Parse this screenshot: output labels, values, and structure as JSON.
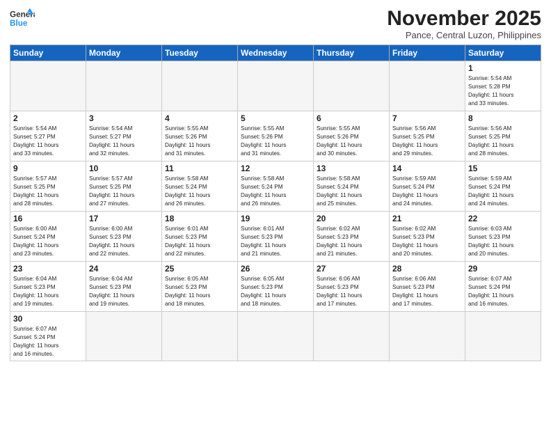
{
  "logo": {
    "line1": "General",
    "line2": "Blue"
  },
  "title": "November 2025",
  "location": "Pance, Central Luzon, Philippines",
  "weekdays": [
    "Sunday",
    "Monday",
    "Tuesday",
    "Wednesday",
    "Thursday",
    "Friday",
    "Saturday"
  ],
  "weeks": [
    [
      {
        "day": "",
        "info": ""
      },
      {
        "day": "",
        "info": ""
      },
      {
        "day": "",
        "info": ""
      },
      {
        "day": "",
        "info": ""
      },
      {
        "day": "",
        "info": ""
      },
      {
        "day": "",
        "info": ""
      },
      {
        "day": "1",
        "info": "Sunrise: 5:54 AM\nSunset: 5:28 PM\nDaylight: 11 hours\nand 33 minutes."
      }
    ],
    [
      {
        "day": "2",
        "info": "Sunrise: 5:54 AM\nSunset: 5:27 PM\nDaylight: 11 hours\nand 33 minutes."
      },
      {
        "day": "3",
        "info": "Sunrise: 5:54 AM\nSunset: 5:27 PM\nDaylight: 11 hours\nand 32 minutes."
      },
      {
        "day": "4",
        "info": "Sunrise: 5:55 AM\nSunset: 5:26 PM\nDaylight: 11 hours\nand 31 minutes."
      },
      {
        "day": "5",
        "info": "Sunrise: 5:55 AM\nSunset: 5:26 PM\nDaylight: 11 hours\nand 31 minutes."
      },
      {
        "day": "6",
        "info": "Sunrise: 5:55 AM\nSunset: 5:26 PM\nDaylight: 11 hours\nand 30 minutes."
      },
      {
        "day": "7",
        "info": "Sunrise: 5:56 AM\nSunset: 5:25 PM\nDaylight: 11 hours\nand 29 minutes."
      },
      {
        "day": "8",
        "info": "Sunrise: 5:56 AM\nSunset: 5:25 PM\nDaylight: 11 hours\nand 28 minutes."
      }
    ],
    [
      {
        "day": "9",
        "info": "Sunrise: 5:57 AM\nSunset: 5:25 PM\nDaylight: 11 hours\nand 28 minutes."
      },
      {
        "day": "10",
        "info": "Sunrise: 5:57 AM\nSunset: 5:25 PM\nDaylight: 11 hours\nand 27 minutes."
      },
      {
        "day": "11",
        "info": "Sunrise: 5:58 AM\nSunset: 5:24 PM\nDaylight: 11 hours\nand 26 minutes."
      },
      {
        "day": "12",
        "info": "Sunrise: 5:58 AM\nSunset: 5:24 PM\nDaylight: 11 hours\nand 26 minutes."
      },
      {
        "day": "13",
        "info": "Sunrise: 5:58 AM\nSunset: 5:24 PM\nDaylight: 11 hours\nand 25 minutes."
      },
      {
        "day": "14",
        "info": "Sunrise: 5:59 AM\nSunset: 5:24 PM\nDaylight: 11 hours\nand 24 minutes."
      },
      {
        "day": "15",
        "info": "Sunrise: 5:59 AM\nSunset: 5:24 PM\nDaylight: 11 hours\nand 24 minutes."
      }
    ],
    [
      {
        "day": "16",
        "info": "Sunrise: 6:00 AM\nSunset: 5:24 PM\nDaylight: 11 hours\nand 23 minutes."
      },
      {
        "day": "17",
        "info": "Sunrise: 6:00 AM\nSunset: 5:23 PM\nDaylight: 11 hours\nand 22 minutes."
      },
      {
        "day": "18",
        "info": "Sunrise: 6:01 AM\nSunset: 5:23 PM\nDaylight: 11 hours\nand 22 minutes."
      },
      {
        "day": "19",
        "info": "Sunrise: 6:01 AM\nSunset: 5:23 PM\nDaylight: 11 hours\nand 21 minutes."
      },
      {
        "day": "20",
        "info": "Sunrise: 6:02 AM\nSunset: 5:23 PM\nDaylight: 11 hours\nand 21 minutes."
      },
      {
        "day": "21",
        "info": "Sunrise: 6:02 AM\nSunset: 5:23 PM\nDaylight: 11 hours\nand 20 minutes."
      },
      {
        "day": "22",
        "info": "Sunrise: 6:03 AM\nSunset: 5:23 PM\nDaylight: 11 hours\nand 20 minutes."
      }
    ],
    [
      {
        "day": "23",
        "info": "Sunrise: 6:04 AM\nSunset: 5:23 PM\nDaylight: 11 hours\nand 19 minutes."
      },
      {
        "day": "24",
        "info": "Sunrise: 6:04 AM\nSunset: 5:23 PM\nDaylight: 11 hours\nand 19 minutes."
      },
      {
        "day": "25",
        "info": "Sunrise: 6:05 AM\nSunset: 5:23 PM\nDaylight: 11 hours\nand 18 minutes."
      },
      {
        "day": "26",
        "info": "Sunrise: 6:05 AM\nSunset: 5:23 PM\nDaylight: 11 hours\nand 18 minutes."
      },
      {
        "day": "27",
        "info": "Sunrise: 6:06 AM\nSunset: 5:23 PM\nDaylight: 11 hours\nand 17 minutes."
      },
      {
        "day": "28",
        "info": "Sunrise: 6:06 AM\nSunset: 5:23 PM\nDaylight: 11 hours\nand 17 minutes."
      },
      {
        "day": "29",
        "info": "Sunrise: 6:07 AM\nSunset: 5:24 PM\nDaylight: 11 hours\nand 16 minutes."
      }
    ],
    [
      {
        "day": "30",
        "info": "Sunrise: 6:07 AM\nSunset: 5:24 PM\nDaylight: 11 hours\nand 16 minutes."
      },
      {
        "day": "",
        "info": ""
      },
      {
        "day": "",
        "info": ""
      },
      {
        "day": "",
        "info": ""
      },
      {
        "day": "",
        "info": ""
      },
      {
        "day": "",
        "info": ""
      },
      {
        "day": "",
        "info": ""
      }
    ]
  ]
}
